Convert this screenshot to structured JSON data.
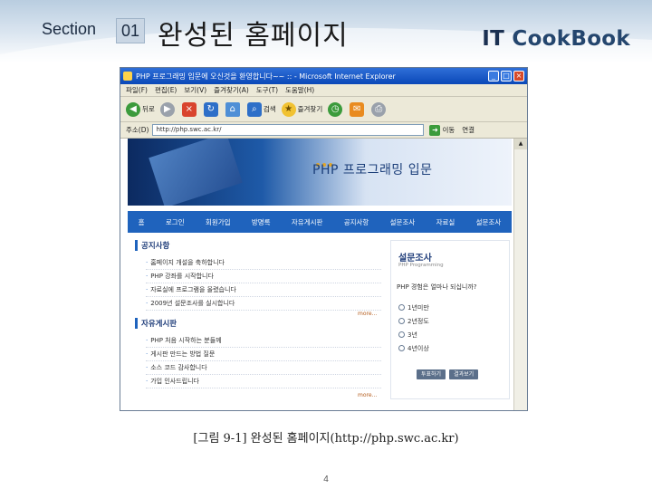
{
  "slide": {
    "section_label": "Section",
    "section_number": "01",
    "title": "완성된 홈페이지",
    "brand_it": "IT",
    "brand_rest": "CookBook",
    "caption": "[그림 9-1] 완성된 홈페이지(http://php.swc.ac.kr)",
    "page_number": "4"
  },
  "browser": {
    "window_title": "PHP 프로그래밍 입문에 오신것을 환영합니다~~ :: - Microsoft Internet Explorer",
    "menus": [
      "파일(F)",
      "편집(E)",
      "보기(V)",
      "즐겨찾기(A)",
      "도구(T)",
      "도움말(H)"
    ],
    "toolbar": {
      "back": "뒤로",
      "search": "검색",
      "favorites": "즐겨찾기"
    },
    "address_label": "주소(D)",
    "address_value": "http://php.swc.ac.kr/",
    "go_label": "이동",
    "links_label": "연결"
  },
  "site": {
    "banner_title": "PHP 프로그래밍 입문",
    "nav": [
      "홈",
      "로그인",
      "회원가입",
      "방명록",
      "자유게시판",
      "공지사항",
      "설문조사",
      "자료실",
      "설문조사"
    ],
    "notice_heading": "공지사항",
    "notices": [
      "홈페이지 개설을 축하합니다",
      "PHP 강좌를 시작합니다",
      "자료실에 프로그램을 올렸습니다",
      "2009년 설문조사를 실시합니다"
    ],
    "more_label": "more...",
    "free_heading": "자유게시판",
    "free_posts": [
      "PHP 처음 시작하는 분들께",
      "게시판 만드는 방법 질문",
      "소스 코드 감사합니다",
      "가입 인사드립니다"
    ],
    "survey": {
      "title": "설문조사",
      "subtitle": "PHP Programming",
      "question": "PHP 경험은 얼마나 되십니까?",
      "options": [
        "1년미만",
        "2년정도",
        "3년",
        "4년이상"
      ],
      "vote_label": "투표하기",
      "result_label": "결과보기"
    }
  }
}
